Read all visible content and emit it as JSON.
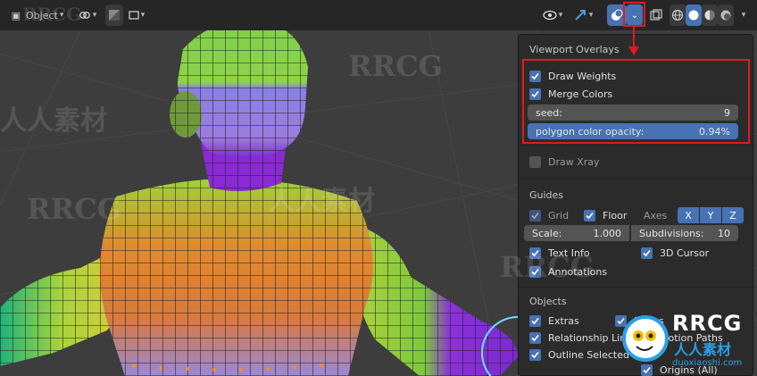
{
  "header": {
    "mode_label": "Object",
    "icons": [
      "object-mode-icon",
      "link-icon",
      "shading-icon",
      "camera-icon",
      "visibility-icon",
      "gizmo-icon",
      "overlays-icon",
      "overlay-dropdown-icon",
      "xray-icon",
      "wireframe-icon",
      "solid-icon",
      "material-icon",
      "rendered-icon"
    ]
  },
  "panel": {
    "title": "Viewport Overlays",
    "draw_weights": {
      "label": "Draw Weights",
      "checked": true
    },
    "merge_colors": {
      "label": "Merge Colors",
      "checked": true
    },
    "seed": {
      "label": "seed:",
      "value": "9"
    },
    "polygon_opacity": {
      "label": "polygon color opacity:",
      "value": "0.94%",
      "fill_fraction": 1.0
    },
    "draw_xray": {
      "label": "Draw Xray",
      "checked": false
    },
    "guides": {
      "title": "Guides",
      "grid": {
        "label": "Grid",
        "checked": true
      },
      "floor": {
        "label": "Floor",
        "checked": true
      },
      "axes_label": "Axes",
      "axes": [
        "X",
        "Y",
        "Z"
      ],
      "scale": {
        "label": "Scale:",
        "value": "1.000"
      },
      "subdivisions": {
        "label": "Subdivisions:",
        "value": "10"
      },
      "text_info": {
        "label": "Text Info",
        "checked": true
      },
      "cursor_3d": {
        "label": "3D Cursor",
        "checked": true
      },
      "annotations": {
        "label": "Annotations",
        "checked": true
      }
    },
    "objects": {
      "title": "Objects",
      "extras": {
        "label": "Extras",
        "checked": true
      },
      "bones": {
        "label": "Bones",
        "checked": true
      },
      "relationship_lines": {
        "label": "Relationship Lines",
        "checked": true
      },
      "motion_paths": {
        "label": "Motion Paths",
        "checked": true
      },
      "outline_selected": {
        "label": "Outline Selected",
        "checked": true
      },
      "origins": {
        "label": "Origins (All)",
        "checked": true
      }
    }
  },
  "watermark": {
    "text": "RRCG",
    "cn_text": "人人素材",
    "logo_text": "RRCG",
    "logo_sub": "人人素材",
    "logo_url": "duoxiaoshi.com"
  },
  "colors": {
    "accent": "#4772b3",
    "highlight": "#e01b1b"
  }
}
